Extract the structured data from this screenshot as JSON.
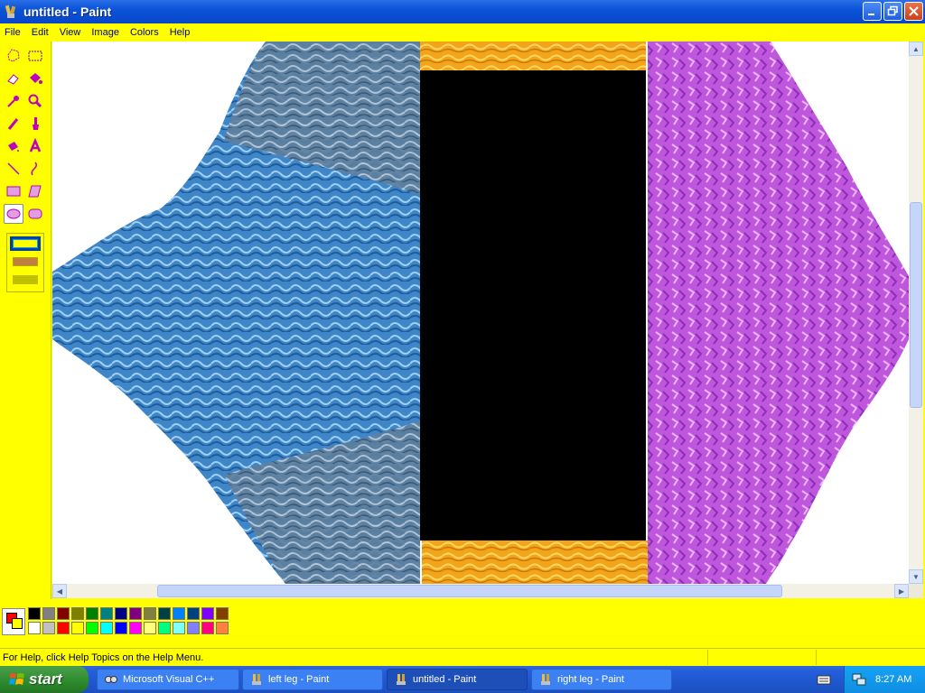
{
  "window": {
    "title": "untitled - Paint"
  },
  "menu": {
    "items": [
      "File",
      "Edit",
      "View",
      "Image",
      "Colors",
      "Help"
    ]
  },
  "toolbox": {
    "tools": [
      "free-form-select",
      "rectangle-select",
      "eraser",
      "fill-bucket",
      "pick-color",
      "magnifier",
      "pencil",
      "brush",
      "airbrush",
      "text",
      "line",
      "curve",
      "rectangle",
      "polygon",
      "ellipse",
      "rounded-rectangle"
    ],
    "selected_tool": "ellipse"
  },
  "palette": {
    "foreground": "#ff0000",
    "background": "#ffff00",
    "top_row": [
      "#000000",
      "#808080",
      "#800000",
      "#808000",
      "#008000",
      "#008080",
      "#000080",
      "#800080",
      "#808040",
      "#004040",
      "#0080ff",
      "#004080",
      "#8000ff",
      "#804000"
    ],
    "bottom_row": [
      "#ffffff",
      "#c0c0c0",
      "#ff0000",
      "#ffff00",
      "#00ff00",
      "#00ffff",
      "#0000ff",
      "#ff00ff",
      "#ffff80",
      "#00ff80",
      "#80ffff",
      "#8080ff",
      "#ff0080",
      "#ff8040"
    ]
  },
  "status": {
    "help_text": "For Help, click Help Topics on the Help Menu."
  },
  "taskbar": {
    "start_label": "start",
    "tasks": [
      {
        "label": "Microsoft Visual C++"
      },
      {
        "label": "left leg - Paint"
      },
      {
        "label": "untitled - Paint"
      },
      {
        "label": "right leg - Paint"
      }
    ],
    "clock": "8:27 AM"
  }
}
